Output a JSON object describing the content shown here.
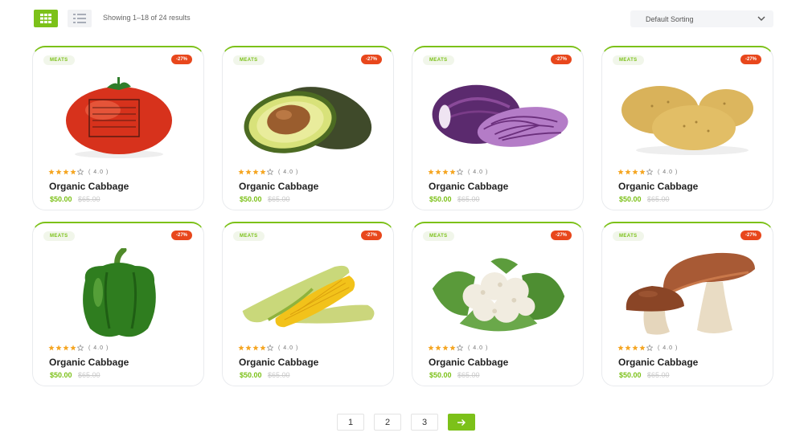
{
  "toolbar": {
    "results_text": "Showing 1–18 of 24 results",
    "sort_label": "Default Sorting",
    "grid_view_icon": "grid-icon",
    "list_view_icon": "list-icon"
  },
  "colors": {
    "accent": "#7cc119",
    "badge": "#e8471c",
    "star": "#f5a623"
  },
  "products": [
    {
      "tag": "MEATS",
      "badge": "-27%",
      "image": "tomato",
      "rating": "( 4.0 )",
      "stars": 4,
      "title": "Organic Cabbage",
      "price": "$50.00",
      "old_price": "$65.00"
    },
    {
      "tag": "MEATS",
      "badge": "-27%",
      "image": "avocado",
      "rating": "( 4.0 )",
      "stars": 4,
      "title": "Organic Cabbage",
      "price": "$50.00",
      "old_price": "$65.00"
    },
    {
      "tag": "MEATS",
      "badge": "-27%",
      "image": "red-cabbage",
      "rating": "( 4.0 )",
      "stars": 4,
      "title": "Organic Cabbage",
      "price": "$50.00",
      "old_price": "$65.00"
    },
    {
      "tag": "MEATS",
      "badge": "-27%",
      "image": "potatoes",
      "rating": "( 4.0 )",
      "stars": 4,
      "title": "Organic Cabbage",
      "price": "$50.00",
      "old_price": "$65.00"
    },
    {
      "tag": "MEATS",
      "badge": "-27%",
      "image": "green-pepper",
      "rating": "( 4.0 )",
      "stars": 4,
      "title": "Organic Cabbage",
      "price": "$50.00",
      "old_price": "$65.00"
    },
    {
      "tag": "MEATS",
      "badge": "-27%",
      "image": "corn",
      "rating": "( 4.0 )",
      "stars": 4,
      "title": "Organic Cabbage",
      "price": "$50.00",
      "old_price": "$65.00"
    },
    {
      "tag": "MEATS",
      "badge": "-27%",
      "image": "cauliflower",
      "rating": "( 4.0 )",
      "stars": 4,
      "title": "Organic Cabbage",
      "price": "$50.00",
      "old_price": "$65.00"
    },
    {
      "tag": "MEATS",
      "badge": "-27%",
      "image": "mushrooms",
      "rating": "( 4.0 )",
      "stars": 4,
      "title": "Organic Cabbage",
      "price": "$50.00",
      "old_price": "$65.00"
    }
  ],
  "pagination": {
    "pages": [
      "1",
      "2",
      "3"
    ],
    "next_icon": "arrow-right-icon"
  }
}
